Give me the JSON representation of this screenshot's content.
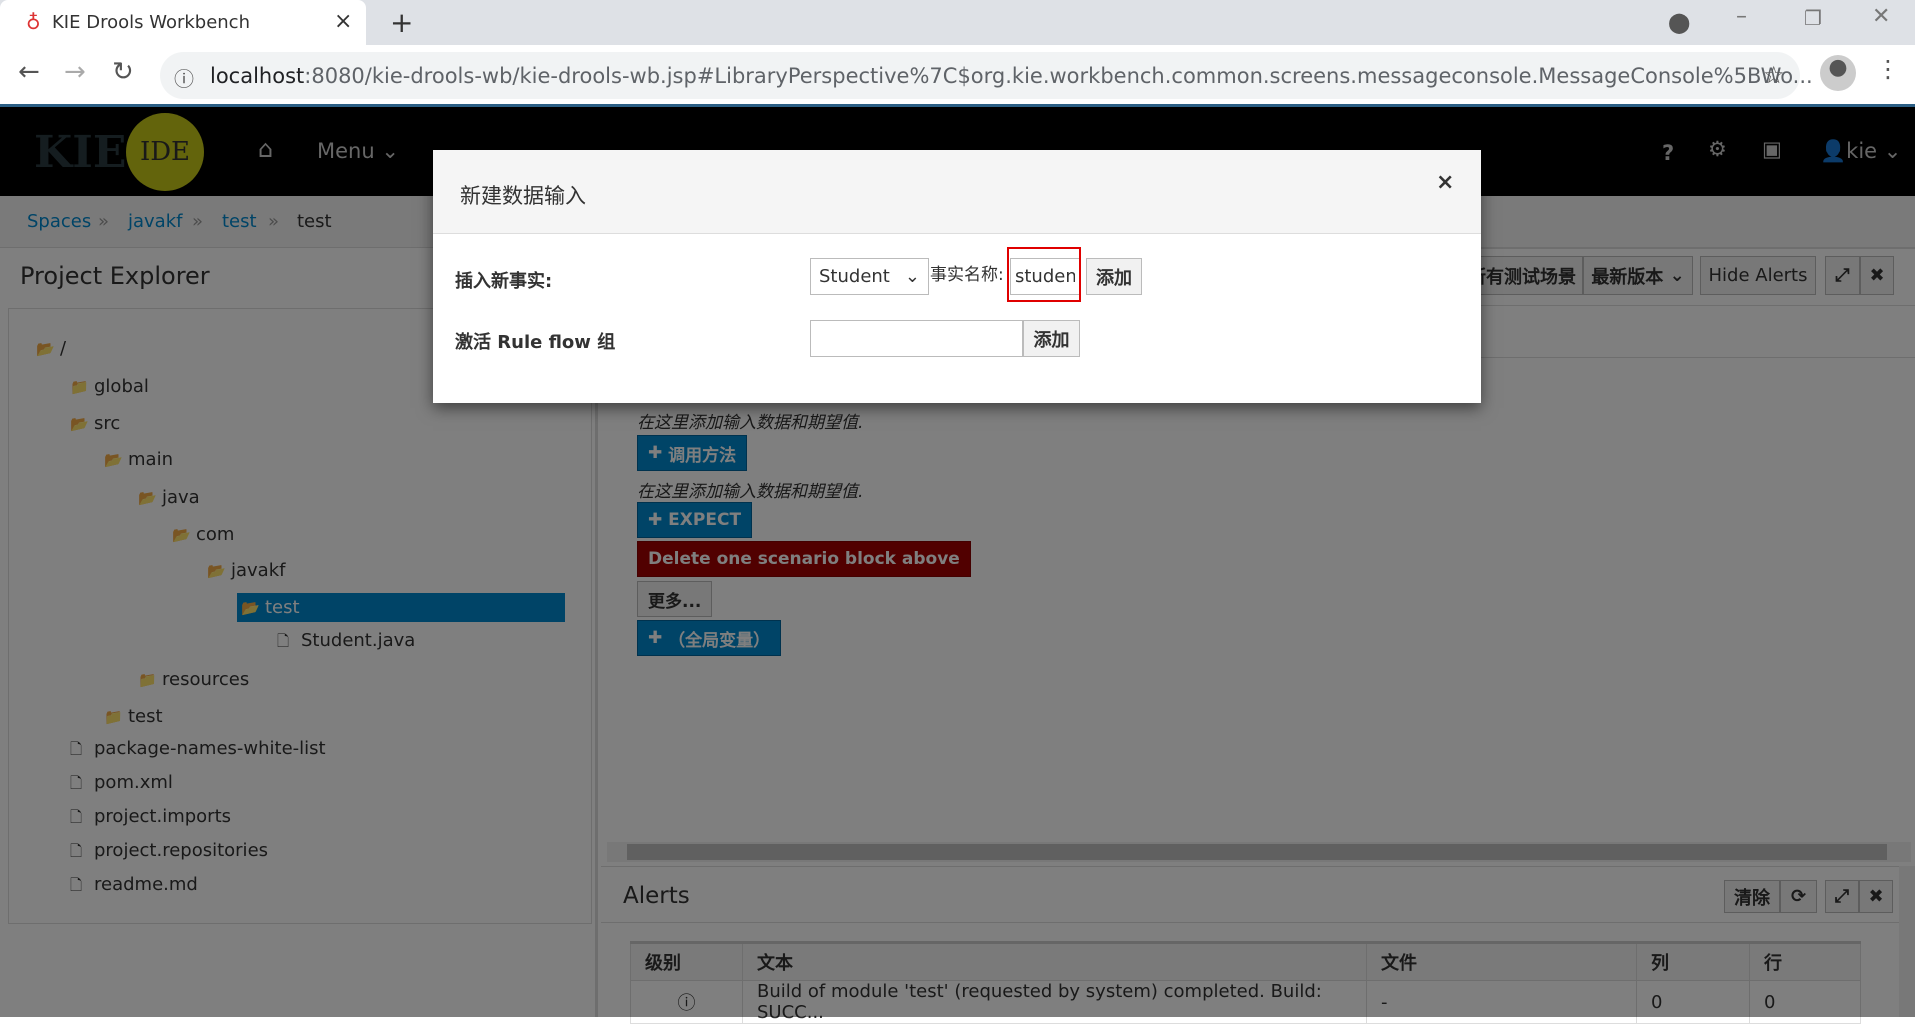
{
  "browser": {
    "tab_title": "KIE Drools Workbench",
    "url_host": "localhost",
    "url_rest": ":8080/kie-drools-wb/kie-drools-wb.jsp#LibraryPerspective%7C$org.kie.workbench.common.screens.messageconsole.MessageConsole%5BWo..."
  },
  "header": {
    "logo_text": "KIE",
    "logo_badge": "IDE",
    "menu": "Menu",
    "user": "kie"
  },
  "breadcrumb": [
    "Spaces",
    "javakf",
    "test",
    "test"
  ],
  "explorer": {
    "title": "Project Explorer",
    "items": [
      "/",
      "global",
      "src",
      "main",
      "java",
      "com",
      "javakf",
      "test",
      "Student.java",
      "resources",
      "test",
      "package-names-white-list",
      "pom.xml",
      "project.imports",
      "project.repositories",
      "readme.md"
    ]
  },
  "toolbar": {
    "run_all": "所有测试场景",
    "version": "最新版本",
    "hide_alerts": "Hide Alerts"
  },
  "editor": {
    "hint1": "在这里添加输入数据和期望值.",
    "call_method": "调用方法",
    "hint2": "在这里添加输入数据和期望值.",
    "expect": "EXPECT",
    "delete_block": "Delete one scenario block above",
    "more": "更多...",
    "globals": "（全局变量）"
  },
  "alerts": {
    "title": "Alerts",
    "clear": "清除",
    "columns": [
      "级别",
      "文本",
      "文件",
      "列",
      "行"
    ],
    "rows": [
      {
        "text": "Build of module 'test' (requested by system) completed. Build: SUCC...",
        "file": "-",
        "column": "0",
        "line": "0"
      }
    ]
  },
  "dialog": {
    "title": "新建数据输入",
    "insert_fact_label": "插入新事实:",
    "fact_type": "Student",
    "fact_name_label": "事实名称:",
    "fact_name_value": "studen",
    "add": "添加",
    "ruleflow_label": "激活 Rule flow 组",
    "ruleflow_value": "",
    "add2": "添加"
  },
  "colors": {
    "accent": "#0088ce",
    "danger": "#a30000",
    "highlight": "#e00000"
  }
}
